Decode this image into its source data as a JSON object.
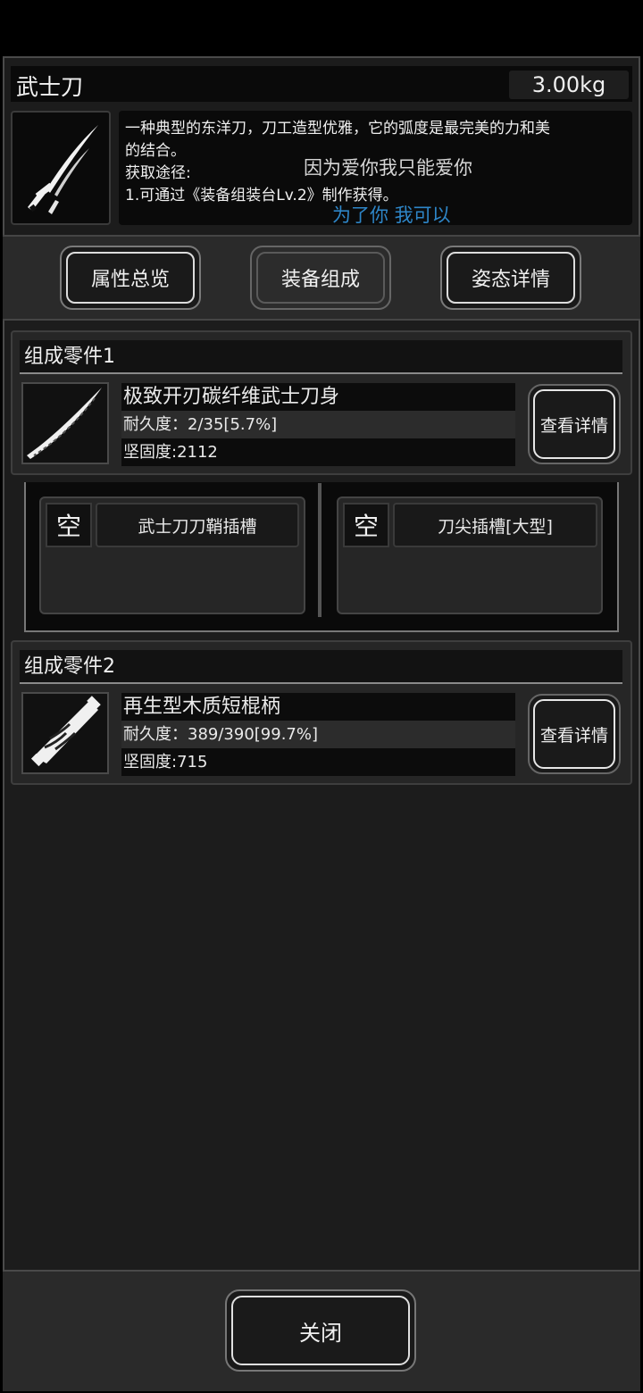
{
  "item": {
    "name": "武士刀",
    "weight": "3.00kg",
    "icon": "katana-icon",
    "description_lines": [
      "一种典型的东洋刀，刀工造型优雅，它的弧度是最完美的力和美",
      "的结合。",
      "获取途径:",
      "1.可通过《装备组装台Lv.2》制作获得。"
    ],
    "overlay_text_1": "因为爱你我只能爱你",
    "overlay_text_2": "为了你 我可以"
  },
  "tabs": [
    {
      "label": "属性总览",
      "active": false
    },
    {
      "label": "装备组成",
      "active": true
    },
    {
      "label": "姿态详情",
      "active": false
    }
  ],
  "components": [
    {
      "header": "组成零件1",
      "part_name": "极致开刃碳纤维武士刀身",
      "durability": "耐久度：2/35[5.7%]",
      "hardness": "坚固度:2112",
      "icon": "blade-icon",
      "detail_label": "查看详情",
      "slots": [
        {
          "state": "空",
          "label": "武士刀刀鞘插槽"
        },
        {
          "state": "空",
          "label": "刀尖插槽[大型]"
        }
      ]
    },
    {
      "header": "组成零件2",
      "part_name": "再生型木质短棍柄",
      "durability": "耐久度：389/390[99.7%]",
      "hardness": "坚固度:715",
      "icon": "wooden-handle-icon",
      "detail_label": "查看详情"
    }
  ],
  "footer": {
    "close_label": "关闭"
  }
}
